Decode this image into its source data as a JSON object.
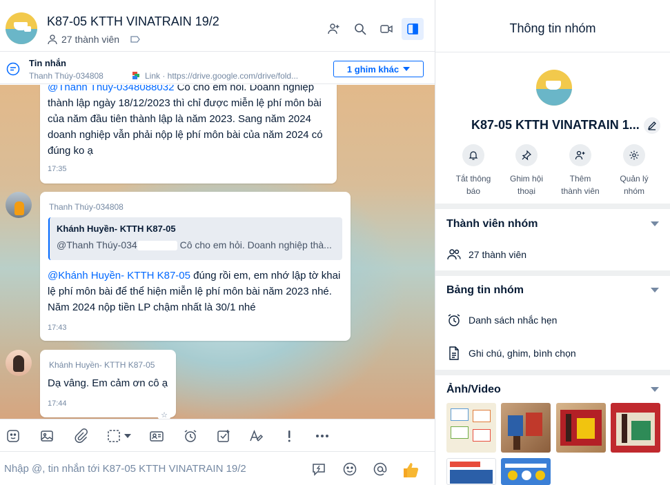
{
  "header": {
    "title": "K87-05 KTTH VINATRAIN 19/2",
    "member_count": "27 thành viên",
    "icons": [
      "add-member-icon",
      "search-icon",
      "video-call-icon",
      "panel-toggle-icon"
    ]
  },
  "pinned": {
    "title": "Tin nhắn",
    "sender": "Thanh Thúy-034808",
    "link_text": "Link · https://drive.google.com/drive/fold...",
    "more_button": "1 ghim khác"
  },
  "messages": [
    {
      "text_mention": "@Thanh Thúy-0348088032",
      "text": " Cô cho em hỏi. Doanh nghiệp thành lập ngày 18/12/2023 thì chỉ được miễn lệ phí môn bài của năm đầu tiên thành lập là năm 2023. Sang năm 2024 doanh nghiệp vẫn phải nộp lệ phí môn bài của năm 2024 có đúng ko ạ",
      "time": "17:35"
    },
    {
      "sender": "Thanh Thúy-034808",
      "quote_name": "Khánh Huyền- KTTH K87-05",
      "quote_prefix": "@Thanh Thúy-034",
      "quote_text": "Cô cho em hỏi. Doanh nghiệp thà...",
      "text_mention": "@Khánh Huyền- KTTH K87-05",
      "text": " đúng rồi em, em nhớ lập tờ khai lệ phí môn bài để thể hiện miễn lệ phí môn bài năm 2023 nhé. Năm 2024 nộp tiền LP chậm nhất là 30/1 nhé",
      "time": "17:43"
    },
    {
      "sender": "Khánh Huyền- KTTH K87-05",
      "text": "Dạ vâng. Em cảm ơn cô ạ",
      "time": "17:44"
    }
  ],
  "composer": {
    "placeholder": "Nhập @, tin nhắn tới K87-05 KTTH VINATRAIN 19/2"
  },
  "info_panel": {
    "title": "Thông tin nhóm",
    "group_name": "K87-05 KTTH VINATRAIN 1...",
    "actions": [
      {
        "label_1": "Tắt thông",
        "label_2": "báo",
        "icon": "bell-icon"
      },
      {
        "label_1": "Ghim hội",
        "label_2": "thoại",
        "icon": "pin-icon"
      },
      {
        "label_1": "Thêm",
        "label_2": "thành viên",
        "icon": "add-member-icon"
      },
      {
        "label_1": "Quản lý",
        "label_2": "nhóm",
        "icon": "gear-icon"
      }
    ],
    "members_section": {
      "title": "Thành viên nhóm",
      "count": "27 thành viên"
    },
    "board_section": {
      "title": "Bảng tin nhóm",
      "reminders": "Danh sách nhắc hẹn",
      "notes": "Ghi chú, ghim, bình chọn"
    },
    "media_section": {
      "title": "Ảnh/Video"
    }
  },
  "colors": {
    "accent": "#0068ff",
    "text": "#081c36",
    "muted": "#7589a3"
  }
}
